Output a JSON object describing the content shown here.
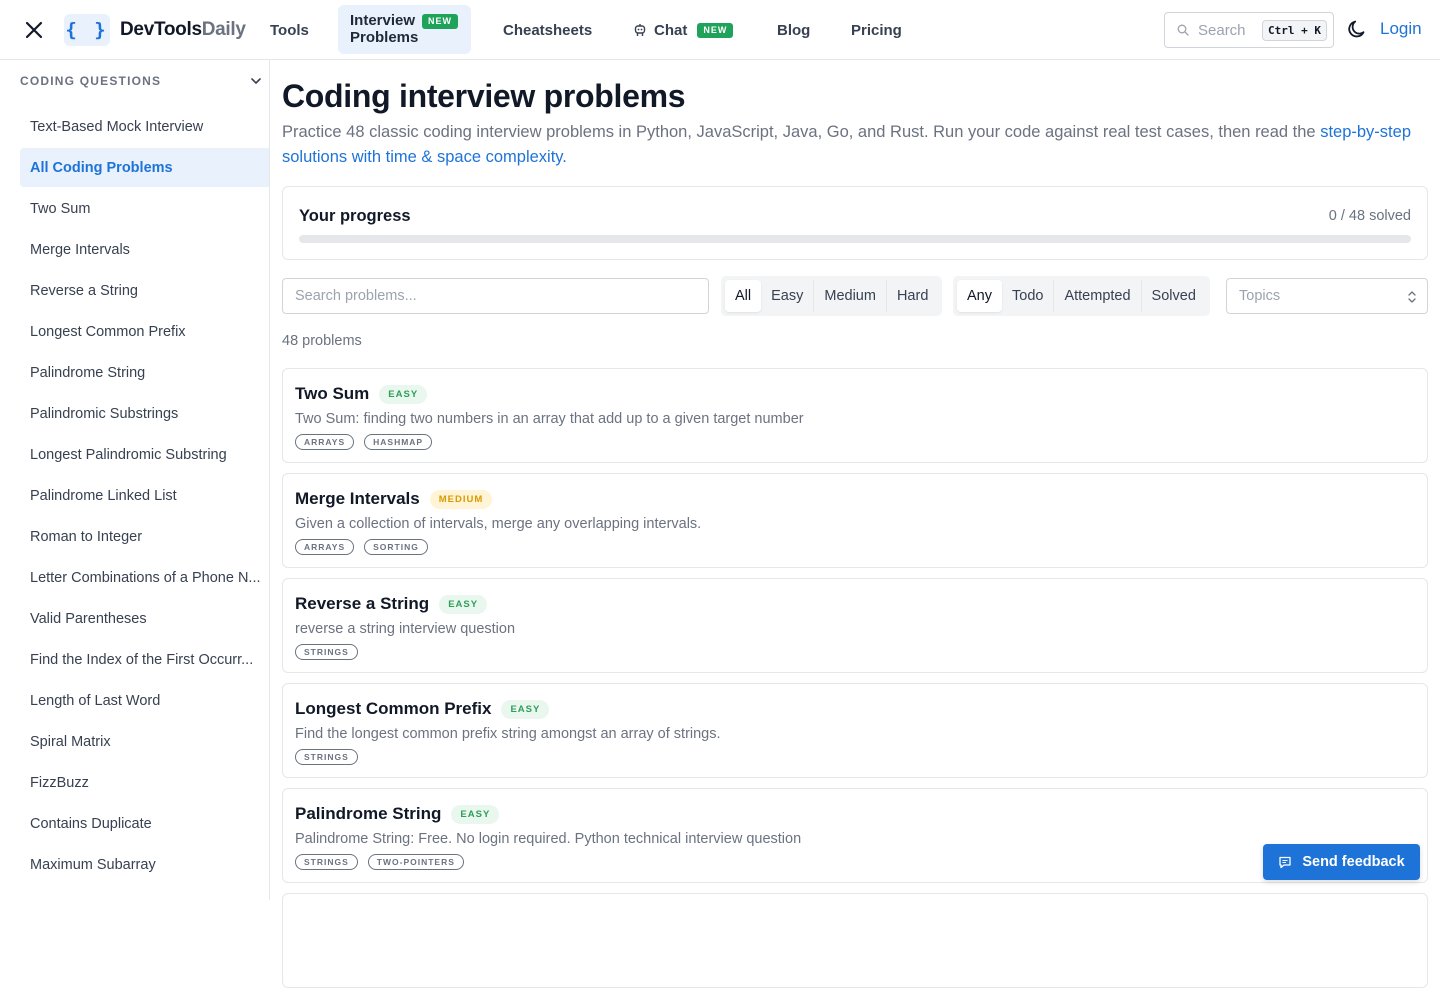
{
  "header": {
    "logo_mark": "{ }",
    "logo_primary": "DevTools",
    "logo_accent": "Daily",
    "nav": {
      "tools": "Tools",
      "interview_line1": "Interview",
      "interview_line2": "Problems",
      "interview_badge": "NEW",
      "cheatsheets": "Cheatsheets",
      "chat": "Chat",
      "chat_badge": "NEW",
      "blog": "Blog",
      "pricing": "Pricing"
    },
    "search": {
      "placeholder": "Search",
      "shortcut": "Ctrl + K"
    },
    "login": "Login"
  },
  "sidebar": {
    "section_title": "CODING QUESTIONS",
    "items": [
      {
        "label": "Text-Based Mock Interview",
        "active": false
      },
      {
        "label": "All Coding Problems",
        "active": true
      },
      {
        "label": "Two Sum",
        "active": false
      },
      {
        "label": "Merge Intervals",
        "active": false
      },
      {
        "label": "Reverse a String",
        "active": false
      },
      {
        "label": "Longest Common Prefix",
        "active": false
      },
      {
        "label": "Palindrome String",
        "active": false
      },
      {
        "label": "Palindromic Substrings",
        "active": false
      },
      {
        "label": "Longest Palindromic Substring",
        "active": false
      },
      {
        "label": "Palindrome Linked List",
        "active": false
      },
      {
        "label": "Roman to Integer",
        "active": false
      },
      {
        "label": "Letter Combinations of a Phone N...",
        "active": false
      },
      {
        "label": "Valid Parentheses",
        "active": false
      },
      {
        "label": "Find the Index of the First Occurr...",
        "active": false
      },
      {
        "label": "Length of Last Word",
        "active": false
      },
      {
        "label": "Spiral Matrix",
        "active": false
      },
      {
        "label": "FizzBuzz",
        "active": false
      },
      {
        "label": "Contains Duplicate",
        "active": false
      },
      {
        "label": "Maximum Subarray",
        "active": false
      }
    ]
  },
  "main": {
    "title": "Coding interview problems",
    "intro_text": "Practice 48 classic coding interview problems in Python, JavaScript, Java, Go, and Rust. Run your code against real test cases, then read the ",
    "intro_link": "step-by-step solutions with time & space complexity.",
    "progress": {
      "label": "Your progress",
      "count_text": "0 / 48 solved",
      "fraction": 0
    },
    "filters": {
      "search_placeholder": "Search problems...",
      "difficulty": [
        "All",
        "Easy",
        "Medium",
        "Hard"
      ],
      "difficulty_selected": "All",
      "status": [
        "Any",
        "Todo",
        "Attempted",
        "Solved"
      ],
      "status_selected": "Any",
      "topics_placeholder": "Topics"
    },
    "problem_count": "48 problems",
    "problems": [
      {
        "title": "Two Sum",
        "difficulty": "EASY",
        "description": "Two Sum: finding two numbers in an array that add up to a given target number",
        "tags": [
          "ARRAYS",
          "HASHMAP"
        ]
      },
      {
        "title": "Merge Intervals",
        "difficulty": "MEDIUM",
        "description": "Given a collection of intervals, merge any overlapping intervals.",
        "tags": [
          "ARRAYS",
          "SORTING"
        ]
      },
      {
        "title": "Reverse a String",
        "difficulty": "EASY",
        "description": "reverse a string interview question",
        "tags": [
          "STRINGS"
        ]
      },
      {
        "title": "Longest Common Prefix",
        "difficulty": "EASY",
        "description": "Find the longest common prefix string amongst an array of strings.",
        "tags": [
          "STRINGS"
        ]
      },
      {
        "title": "Palindrome String",
        "difficulty": "EASY",
        "description": "Palindrome String: Free. No login required. Python technical interview question",
        "tags": [
          "STRINGS",
          "TWO-POINTERS"
        ]
      },
      {
        "title": "",
        "difficulty": "",
        "description": "",
        "tags": []
      }
    ]
  },
  "feedback": {
    "label": "Send feedback"
  },
  "colors": {
    "accent": "#1e73d8",
    "accent_bg": "#e8f1fc",
    "badge_new": "#1fa35a",
    "easy": "#2e9e5a",
    "medium": "#d99a00"
  },
  "icons": {
    "close": "close-icon",
    "search": "search-icon",
    "chat": "chat-bot-icon",
    "theme": "moon-icon",
    "chevron": "chevron-down-icon",
    "select": "chevron-up-down-icon",
    "feedback": "message-icon"
  }
}
